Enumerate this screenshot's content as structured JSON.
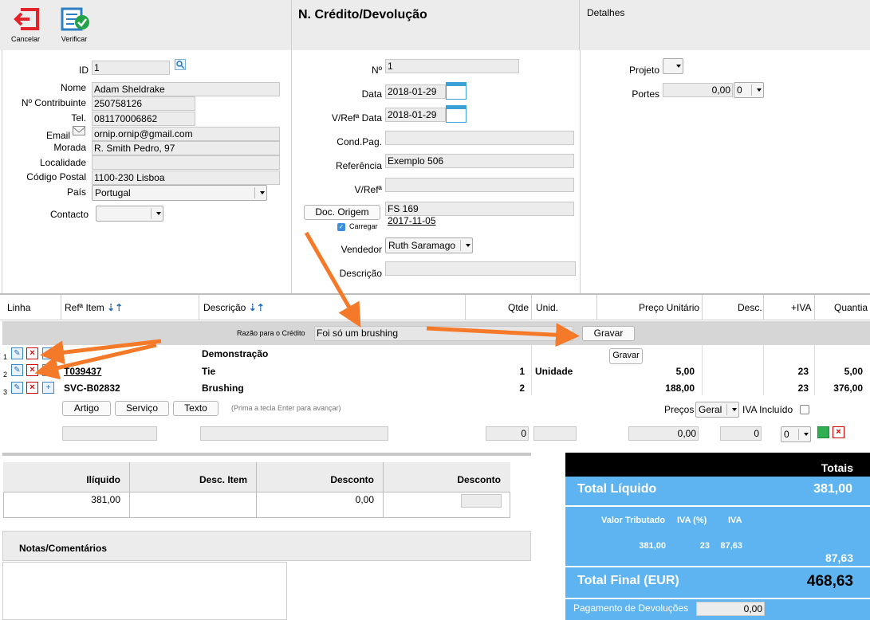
{
  "toolbar": {
    "cancel_label": "Cancelar",
    "verify_label": "Verificar"
  },
  "doc": {
    "title": "N. Crédito/Devolução",
    "details_title": "Detalhes"
  },
  "client": {
    "id_label": "ID",
    "id_value": "1",
    "name_label": "Nome",
    "name_value": "Adam Sheldrake",
    "nif_label": "Nº Contribuinte",
    "nif_value": "250758126",
    "tel_label": "Tel.",
    "tel_value": "081170006862",
    "email_label": "Email",
    "email_value": "ornip.ornip@gmail.com",
    "address_label": "Morada",
    "address_value": "R. Smith Pedro, 97",
    "locality_label": "Localidade",
    "locality_value": "",
    "postal_label": "Código Postal",
    "postal_value": "1100-230 Lisboa",
    "country_label": "País",
    "country_value": "Portugal",
    "contact_label": "Contacto",
    "contact_value": ""
  },
  "document": {
    "number_label": "Nº",
    "number_value": "1",
    "date_label": "Data",
    "date_value": "2018-01-29",
    "vref_date_label": "V/Refª Data",
    "vref_date_value": "2018-01-29",
    "cond_label": "Cond.Pag.",
    "cond_value": "",
    "ref_label": "Referência",
    "ref_value": "Exemplo 506",
    "vref_label": "V/Refª",
    "vref_value": "",
    "origin_button": "Doc. Origem",
    "origin_value": "FS 169",
    "origin_date": "2017-11-05",
    "load_label": "Carregar",
    "seller_label": "Vendedor",
    "seller_value": "Ruth Saramago",
    "desc_label": "Descrição",
    "desc_value": ""
  },
  "details": {
    "project_label": "Projeto",
    "project_value": "",
    "portes_label": "Portes",
    "portes_value": "0,00",
    "portes_select": "0"
  },
  "lines": {
    "headers": {
      "line": "Linha",
      "ref": "Refª Item",
      "desc": "Descrição",
      "qty": "Qtde",
      "unit": "Unid.",
      "price": "Preço Unitário",
      "discount": "Desc.",
      "vat": "+IVA",
      "amount": "Quantia"
    },
    "reason_label": "Razão para o Crédito",
    "reason_value": "Foi só um brushing",
    "save_label": "Gravar",
    "save_label2": "Gravar",
    "rows": [
      {
        "n": "1",
        "ref": "",
        "desc": "Demonstração",
        "qty": "",
        "unit": "",
        "price": "",
        "disc": "",
        "vat": "",
        "amount": ""
      },
      {
        "n": "2",
        "ref": "T039437",
        "desc": "Tie",
        "qty": "1",
        "unit": "Unidade",
        "price": "5,00",
        "disc": "",
        "vat": "23",
        "amount": "5,00"
      },
      {
        "n": "3",
        "ref": "SVC-B02832",
        "desc": "Brushing",
        "qty": "2",
        "unit": "",
        "price": "188,00",
        "disc": "",
        "vat": "23",
        "amount": "376,00"
      }
    ],
    "add_article": "Artigo",
    "add_service": "Serviço",
    "add_text": "Texto",
    "hint": "(Prima a tecla Enter para avançar)",
    "prices_label": "Preços",
    "prices_value": "Geral",
    "vat_included_label": "IVA Incluído",
    "new_qty": "0",
    "new_price": "0,00",
    "new_disc": "0",
    "new_vat": "0"
  },
  "summary": {
    "illiquid_label": "Ilíquido",
    "item_disc_label": "Desc. Item",
    "discount_label": "Desconto",
    "discount2_label": "Desconto",
    "illiquid_value": "381,00",
    "discount_value": "0,00"
  },
  "notes": {
    "title": "Notas/Comentários"
  },
  "totals": {
    "title": "Totais",
    "net_label": "Total Líquido",
    "net_value": "381,00",
    "taxed_label": "Valor Tributado",
    "vat_pct_label": "IVA (%)",
    "vat_label": "IVA",
    "taxed_value": "381,00",
    "vat_pct_value": "23",
    "vat_value": "87,63",
    "vat_total": "87,63",
    "final_label": "Total Final (EUR)",
    "final_value": "468,63",
    "refund_label": "Pagamento de Devoluções",
    "refund_value": "0,00"
  },
  "colors": {
    "accent_blue": "#5db4f0",
    "arrow_orange": "#f47a2a",
    "cancel_red": "#e0242a"
  }
}
